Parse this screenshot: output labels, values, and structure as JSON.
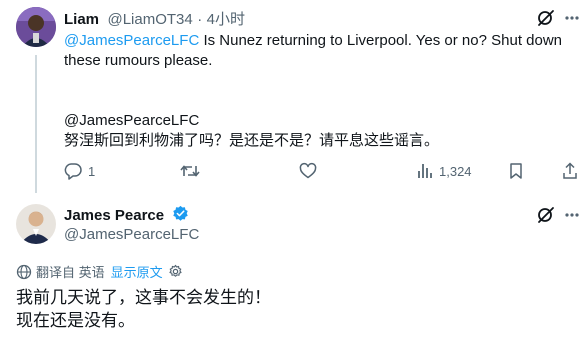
{
  "tweet1": {
    "author_name": "Liam",
    "handle": "@LiamOT34",
    "separator": "·",
    "time": "4小时",
    "mention": "@JamesPearceLFC",
    "text_line1_rest": " Is Nunez returning to Liverpool. Yes or no? Shut down",
    "text_line2": "these rumours please.",
    "translation_mention": "@JamesPearceLFC",
    "translation_text": "努涅斯回到利物浦了吗？是还是不是？请平息这些谣言。",
    "reply_count": "1",
    "views_count": "1,324"
  },
  "tweet2": {
    "author_name": "James Pearce",
    "handle": "@JamesPearceLFC",
    "translated_from": "翻译自 英语",
    "show_original": "显示原文",
    "text_line1": "我前几天说了，这事不会发生的！",
    "text_line2": "现在还是没有。"
  },
  "colors": {
    "accent": "#1d9bf0",
    "muted": "#536471",
    "text": "#0f1419",
    "divider": "#eff3f4"
  }
}
